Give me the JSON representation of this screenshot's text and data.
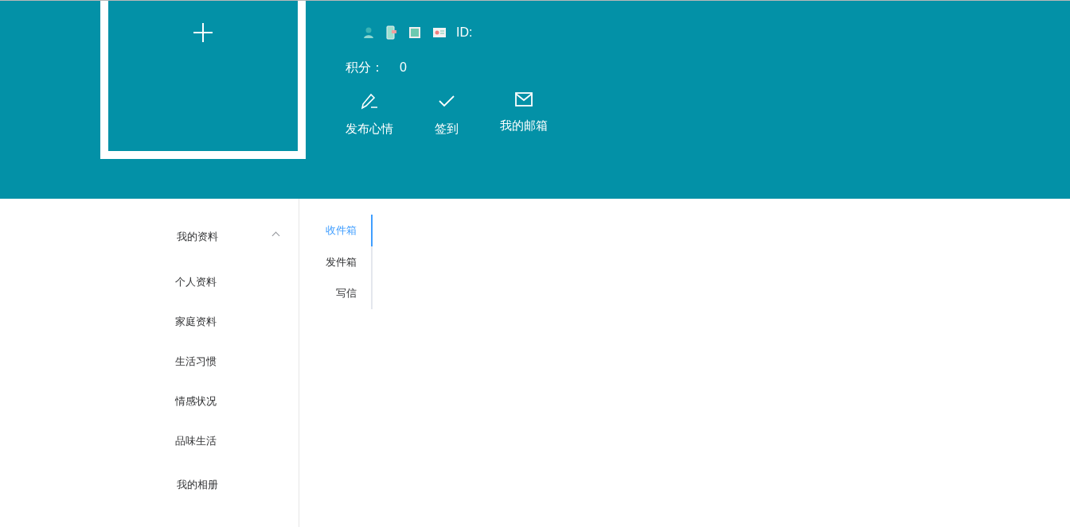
{
  "header": {
    "id_label": "ID:",
    "points_label": "积分：",
    "points": "0",
    "actions": [
      {
        "kind": "pencil",
        "label": "发布心情"
      },
      {
        "kind": "check",
        "label": "签到"
      },
      {
        "kind": "mail",
        "label": "我的邮箱"
      }
    ]
  },
  "menu": [
    {
      "label": "我的资料",
      "expanded": true,
      "children": [
        {
          "label": "个人资料"
        },
        {
          "label": "家庭资料"
        },
        {
          "label": "生活习惯"
        },
        {
          "label": "情感状况"
        },
        {
          "label": "品味生活"
        }
      ]
    },
    {
      "label": "我的相册"
    }
  ],
  "tabs": [
    {
      "label": "收件箱",
      "selected": true
    },
    {
      "label": "发件箱",
      "selected": false
    },
    {
      "label": "写信",
      "selected": false
    }
  ]
}
